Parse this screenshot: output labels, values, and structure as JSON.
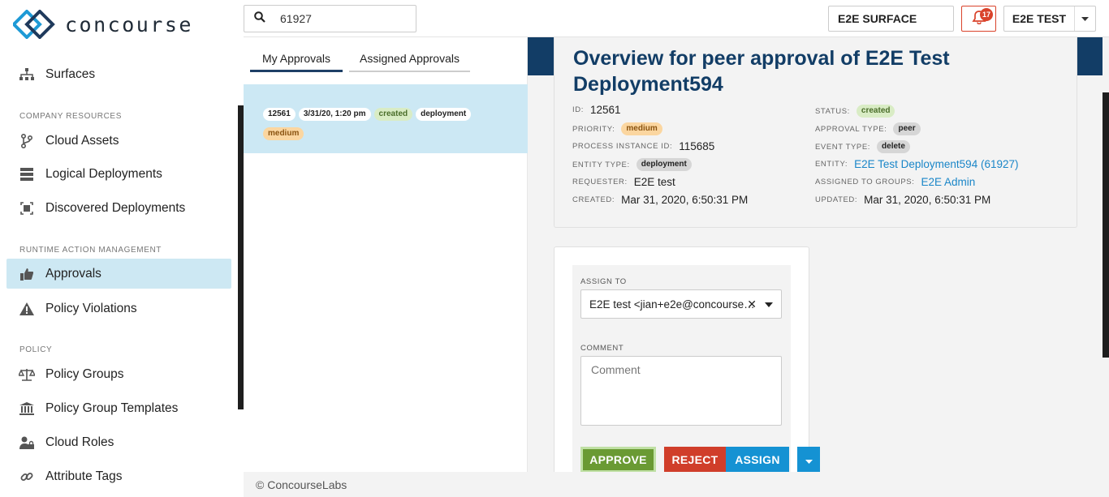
{
  "app": {
    "logo_text": "concourse"
  },
  "search": {
    "value": "61927"
  },
  "header": {
    "surface_label": "E2E SURFACE",
    "notifications_count": "17",
    "user_label": "E2E TEST"
  },
  "nav": {
    "surfaces": "Surfaces",
    "section_company": "COMPANY RESOURCES",
    "cloud_assets": "Cloud Assets",
    "logical_deployments": "Logical Deployments",
    "discovered_deployments": "Discovered Deployments",
    "section_runtime": "RUNTIME ACTION MANAGEMENT",
    "approvals": "Approvals",
    "policy_violations": "Policy Violations",
    "section_policy": "POLICY",
    "policy_groups": "Policy Groups",
    "policy_group_templates": "Policy Group Templates",
    "cloud_roles": "Cloud Roles",
    "attribute_tags": "Attribute Tags"
  },
  "tabs": {
    "my_approvals": "My Approvals",
    "assigned_approvals": "Assigned Approvals"
  },
  "approval_card": {
    "id": "12561",
    "date": "3/31/20, 1:20 pm",
    "status": "created",
    "entity_type": "deployment",
    "priority": "medium"
  },
  "overview": {
    "title": "Overview for peer approval of E2E Test Deployment594",
    "id_label": "ID:",
    "id": "12561",
    "priority_label": "PRIORITY:",
    "priority": "medium",
    "process_label": "PROCESS INSTANCE ID:",
    "process_id": "115685",
    "entity_type_label": "ENTITY TYPE:",
    "entity_type": "deployment",
    "requester_label": "REQUESTER:",
    "requester": "E2E test",
    "created_label": "CREATED:",
    "created": "Mar 31, 2020, 6:50:31 PM",
    "status_label": "STATUS:",
    "status": "created",
    "approval_type_label": "APPROVAL TYPE:",
    "approval_type": "peer",
    "event_type_label": "EVENT TYPE:",
    "event_type": "delete",
    "entity_label": "ENTITY:",
    "entity": "E2E Test Deployment594 (61927)",
    "groups_label": "ASSIGNED TO GROUPS:",
    "groups": "E2E Admin",
    "updated_label": "UPDATED:",
    "updated": "Mar 31, 2020, 6:50:31 PM"
  },
  "assign_form": {
    "assign_to_label": "ASSIGN TO",
    "assign_to_value": "E2E test <jian+e2e@concourse…",
    "clear_glyph": "✕",
    "comment_label": "COMMENT",
    "comment_placeholder": "Comment",
    "approve": "APPROVE",
    "reject": "REJECT",
    "assign": "ASSIGN"
  },
  "footer": {
    "text": "© ConcourseLabs"
  },
  "colors": {
    "brand": "#123d66",
    "approve": "#6a9a33",
    "reject": "#d03e2a",
    "assign": "#1592d3",
    "active_nav": "#cde8f3"
  }
}
